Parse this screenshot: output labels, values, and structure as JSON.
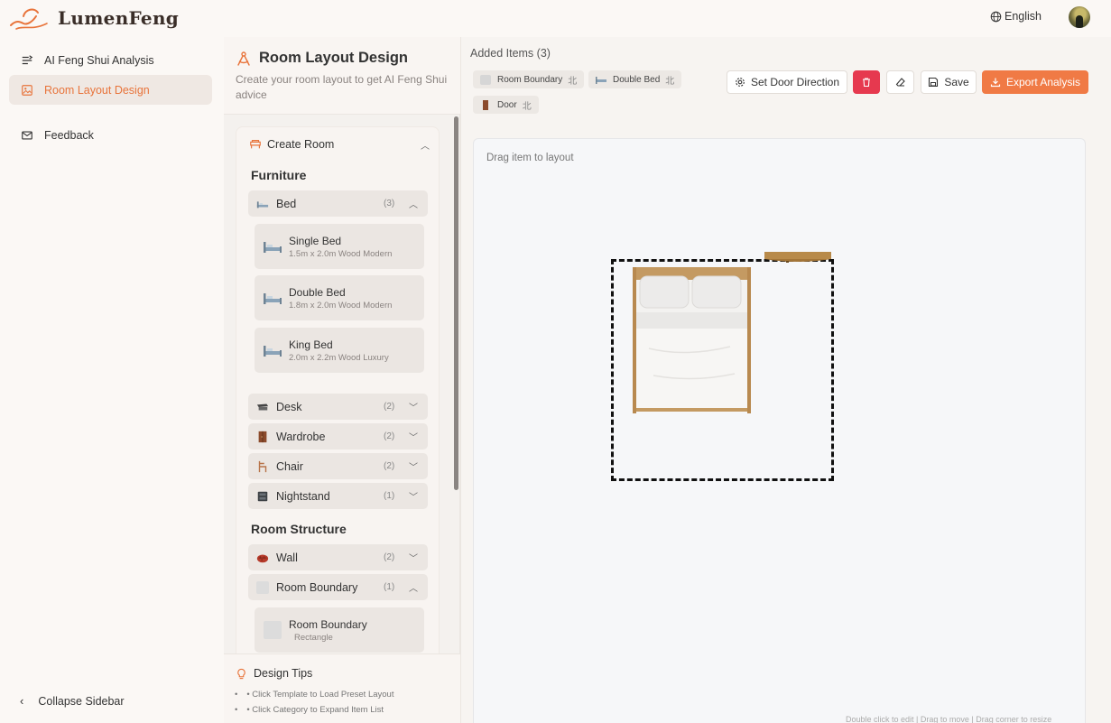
{
  "app": {
    "name": "LumenFeng",
    "language": "English"
  },
  "sidebar": {
    "items": [
      {
        "label": "AI Feng Shui Analysis",
        "icon": "analysis-icon",
        "active": false
      },
      {
        "label": "Room Layout Design",
        "icon": "image-icon",
        "active": true
      },
      {
        "label": "Feedback",
        "icon": "mail-icon",
        "active": false
      }
    ],
    "collapse_label": "Collapse Sidebar"
  },
  "panel": {
    "title": "Room Layout Design",
    "subtitle": "Create your room layout to get AI Feng Shui advice",
    "create_room": "Create Room",
    "furniture_title": "Furniture",
    "structure_title": "Room Structure",
    "categories": [
      {
        "label": "Bed",
        "count": "(3)",
        "expanded": true
      },
      {
        "label": "Desk",
        "count": "(2)",
        "expanded": false
      },
      {
        "label": "Wardrobe",
        "count": "(2)",
        "expanded": false
      },
      {
        "label": "Chair",
        "count": "(2)",
        "expanded": false
      },
      {
        "label": "Nightstand",
        "count": "(1)",
        "expanded": false
      }
    ],
    "bed_items": [
      {
        "name": "Single Bed",
        "spec": "1.5m x 2.0m Wood Modern"
      },
      {
        "name": "Double Bed",
        "spec": "1.8m x 2.0m Wood Modern"
      },
      {
        "name": "King Bed",
        "spec": "2.0m x 2.2m Wood Luxury"
      }
    ],
    "structure": [
      {
        "label": "Wall",
        "count": "(2)",
        "expanded": false
      },
      {
        "label": "Room Boundary",
        "count": "(1)",
        "expanded": true
      }
    ],
    "boundary_item": {
      "name": "Room Boundary",
      "spec": "Rectangle"
    },
    "tips_title": "Design Tips",
    "tips": [
      "• Click Template to Load Preset Layout",
      "• Click Category to Expand Item List"
    ]
  },
  "main": {
    "added_title": "Added Items (3)",
    "added_items": [
      {
        "label": "Room Boundary",
        "dir": "北"
      },
      {
        "label": "Double Bed",
        "dir": "北"
      },
      {
        "label": "Door",
        "dir": "北"
      }
    ],
    "buttons": {
      "door_direction": "Set Door Direction",
      "save": "Save",
      "export": "Export Analysis"
    },
    "canvas_hint": "Drag item to layout",
    "canvas_footer": "Double click to edit | Drag to move | Drag corner to resize"
  },
  "colors": {
    "accent": "#e8743b",
    "danger": "#e6394f",
    "export": "#f07a45"
  }
}
